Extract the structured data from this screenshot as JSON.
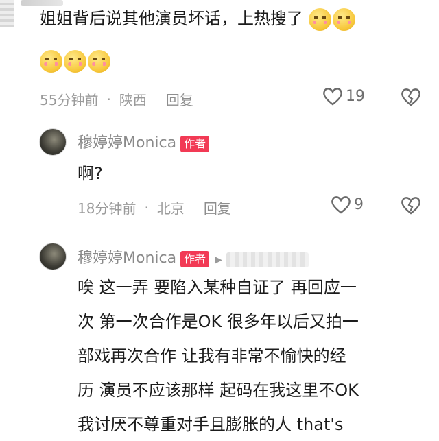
{
  "top_comment": {
    "text": "姐姐背后说其他演员坏话，上热搜了",
    "emojis_inline": [
      "flushed-face-emoji",
      "flushed-face-emoji"
    ],
    "emojis_line2": [
      "flushed-face-emoji",
      "flushed-face-emoji",
      "flushed-face-emoji"
    ],
    "time": "55分钟前",
    "location": "陕西",
    "reply_label": "回复",
    "likes": "19"
  },
  "reply1": {
    "username": "穆婷婷Monica",
    "badge": "作者",
    "text": "啊?",
    "time": "18分钟前",
    "location": "北京",
    "reply_label": "回复",
    "likes": "9"
  },
  "reply2": {
    "username": "穆婷婷Monica",
    "badge": "作者",
    "arrow": "▶",
    "lines": [
      "唉 这一弄 要陷入某种自证了 再回应一",
      "次 第一次合作是OK 很多年以后又拍一",
      "部戏再次合作 让我有非常不愉快的经",
      "历 演员不应该那样 起码在我这里不OK",
      "我讨厌不尊重对手且膨胀的人 that's"
    ]
  },
  "dot": "·"
}
